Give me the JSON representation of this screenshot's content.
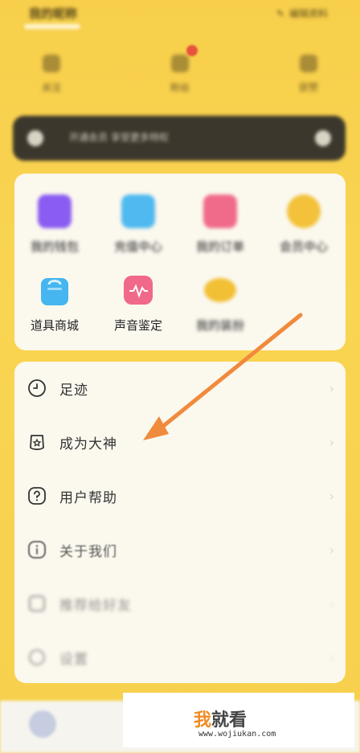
{
  "header": {
    "username": "我的昵称",
    "right_text": "编辑资料",
    "stats": [
      {
        "label": "关注"
      },
      {
        "label": "粉丝"
      },
      {
        "label": "获赞"
      }
    ]
  },
  "notice": {
    "text": "开通会员 享受更多特权"
  },
  "tools": [
    {
      "name": "我的钱包",
      "color": "#8a5cf2",
      "icon": "wallet-icon"
    },
    {
      "name": "充值中心",
      "color": "#4fb9f0",
      "icon": "recharge-icon"
    },
    {
      "name": "我的订单",
      "color": "#f06b8a",
      "icon": "order-icon"
    },
    {
      "name": "会员中心",
      "color": "#f3c23a",
      "icon": "vip-icon"
    },
    {
      "name": "道具商城",
      "color": "#45b6ef",
      "icon": "shopping-bag-icon"
    },
    {
      "name": "声音鉴定",
      "color": "#f0688a",
      "icon": "voice-wave-icon"
    },
    {
      "name": "我的装扮",
      "color": "#f2c035",
      "icon": "heart-badge-icon"
    }
  ],
  "menu": [
    {
      "label": "足迹",
      "icon": "clock-icon"
    },
    {
      "label": "成为大神",
      "icon": "god-badge-icon"
    },
    {
      "label": "用户帮助",
      "icon": "help-icon"
    },
    {
      "label": "关于我们",
      "icon": "info-icon"
    },
    {
      "label": "推荐给好友",
      "icon": "share-icon"
    },
    {
      "label": "设置",
      "icon": "settings-icon"
    }
  ],
  "watermark": {
    "logo_first": "我",
    "logo_rest": "就看",
    "url": "www.wojiukan.com"
  }
}
